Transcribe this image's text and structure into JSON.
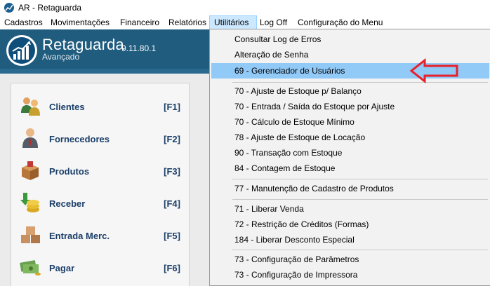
{
  "window": {
    "title": "AR - Retaguarda"
  },
  "menubar": {
    "items": [
      {
        "label": "Cadastros"
      },
      {
        "label": "Movimentações"
      },
      {
        "label": "Financeiro"
      },
      {
        "label": "Relatórios"
      },
      {
        "label": "Utilitários"
      },
      {
        "label": "Log Off"
      },
      {
        "label": "Configuração do Menu"
      }
    ]
  },
  "header": {
    "brand": "Retaguarda",
    "version": "9.11.80.1",
    "edition": "Avançado"
  },
  "shortcuts": [
    {
      "label": "Clientes",
      "key": "[F1]",
      "icon": "clients-icon"
    },
    {
      "label": "Fornecedores",
      "key": "[F2]",
      "icon": "supplier-icon"
    },
    {
      "label": "Produtos",
      "key": "[F3]",
      "icon": "box-icon"
    },
    {
      "label": "Receber",
      "key": "[F4]",
      "icon": "coins-receive-icon"
    },
    {
      "label": "Entrada Merc.",
      "key": "[F5]",
      "icon": "boxes-icon"
    },
    {
      "label": "Pagar",
      "key": "[F6]",
      "icon": "money-icon"
    }
  ],
  "utilitarios_menu": {
    "items": [
      {
        "label": "Consultar Log de Erros"
      },
      {
        "label": "Alteração de Senha"
      },
      {
        "label": "69 - Gerenciador de Usuários"
      },
      {
        "label": "70 - Ajuste de Estoque p/ Balanço"
      },
      {
        "label": "70 - Entrada / Saída do Estoque por Ajuste"
      },
      {
        "label": "70 - Cálculo de Estoque Mínimo"
      },
      {
        "label": "78 - Ajuste de Estoque de Locação"
      },
      {
        "label": "90 - Transação com Estoque"
      },
      {
        "label": "84 - Contagem de Estoque"
      },
      {
        "label": "77 - Manutenção de Cadastro de Produtos"
      },
      {
        "label": "71 - Liberar Venda"
      },
      {
        "label": "72 - Restrição de Créditos (Formas)"
      },
      {
        "label": "184 - Liberar Desconto Especial"
      },
      {
        "label": "73 - Configuração de Parâmetros"
      },
      {
        "label": "73 - Configuração de Impressora"
      }
    ],
    "highlighted": "69 - Gerenciador de Usuários"
  },
  "annotation": {
    "icon": "red-arrow-icon",
    "color": "#e8202a"
  },
  "colors": {
    "header": "#1f5c7e",
    "highlight": "#91c9f7",
    "shortcut_text": "#1b3f69"
  }
}
